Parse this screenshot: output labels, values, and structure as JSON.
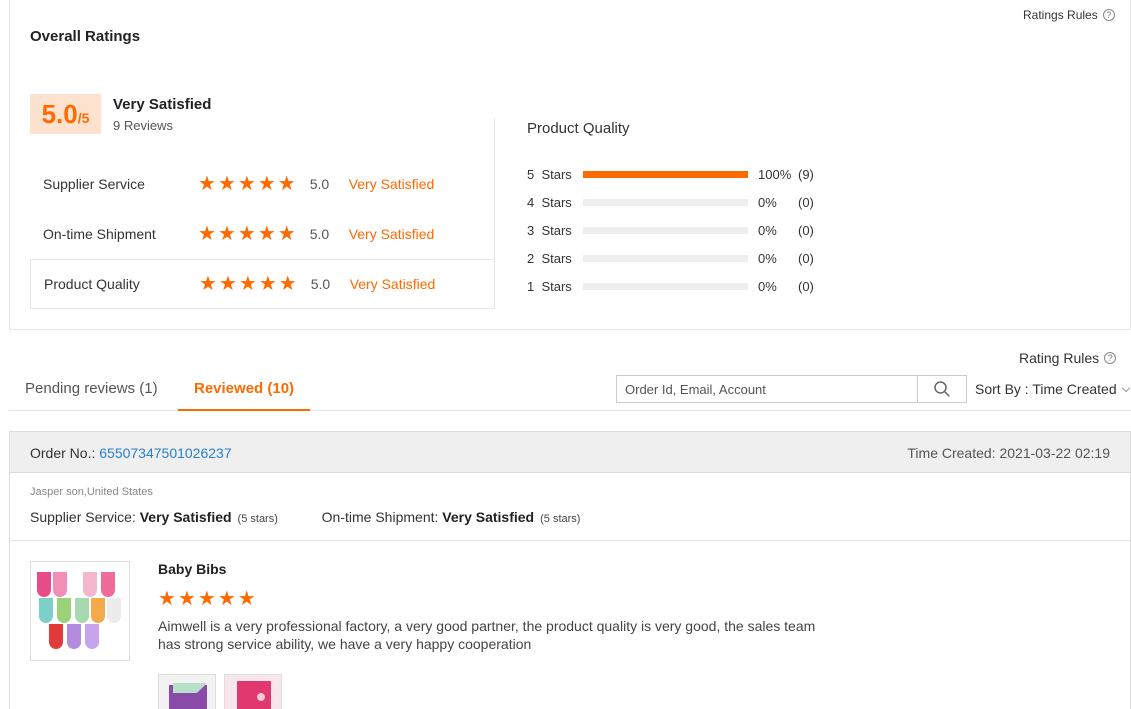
{
  "ratings_rules_top": "Ratings Rules",
  "overall": {
    "title": "Overall Ratings",
    "score": "5.0",
    "score_max": "/5",
    "satisfaction": "Very Satisfied",
    "reviews": "9 Reviews"
  },
  "metrics": [
    {
      "label": "Supplier Service",
      "stars": 5,
      "score": "5.0",
      "satisfaction": "Very Satisfied"
    },
    {
      "label": "On-time Shipment",
      "stars": 5,
      "score": "5.0",
      "satisfaction": "Very Satisfied"
    },
    {
      "label": "Product Quality",
      "stars": 5,
      "score": "5.0",
      "satisfaction": "Very Satisfied"
    }
  ],
  "product_quality": {
    "title": "Product Quality",
    "rows": [
      {
        "label": "5  Stars",
        "percent": 100,
        "percent_text": "100%",
        "count": "(9)"
      },
      {
        "label": "4  Stars",
        "percent": 0,
        "percent_text": "0%",
        "count": "(0)"
      },
      {
        "label": "3  Stars",
        "percent": 0,
        "percent_text": "0%",
        "count": "(0)"
      },
      {
        "label": "2  Stars",
        "percent": 0,
        "percent_text": "0%",
        "count": "(0)"
      },
      {
        "label": "1  Stars",
        "percent": 0,
        "percent_text": "0%",
        "count": "(0)"
      }
    ]
  },
  "rating_rules_mid": "Rating Rules",
  "tabs": [
    {
      "label": "Pending reviews (1)",
      "active": false
    },
    {
      "label": "Reviewed (10)",
      "active": true
    }
  ],
  "search": {
    "placeholder": "Order Id, Email, Account"
  },
  "sort": {
    "label": "Sort By : Time Created"
  },
  "review": {
    "order_label": "Order No.: ",
    "order_id": "65507347501026237",
    "time_created": "Time Created: 2021-03-22 02:19",
    "reviewer": "Jasper son,United States",
    "supplier_label": "Supplier Service: ",
    "supplier_value": "Very Satisfied",
    "supplier_stars": "(5 stars)",
    "shipment_label": "On-time Shipment: ",
    "shipment_value": "Very Satisfied",
    "shipment_stars": "(5 stars)",
    "product_name": "Baby Bibs",
    "product_stars": 5,
    "text": "Aimwell is a very professional factory, a very good partner, the product quality is very good, the sales team has strong service ability, we have a very happy cooperation"
  },
  "colors": {
    "accent": "#ff6a00",
    "link": "#2a7fc9"
  },
  "icons": [
    "question-icon",
    "search-icon",
    "chevron-down-icon",
    "star-icon"
  ]
}
